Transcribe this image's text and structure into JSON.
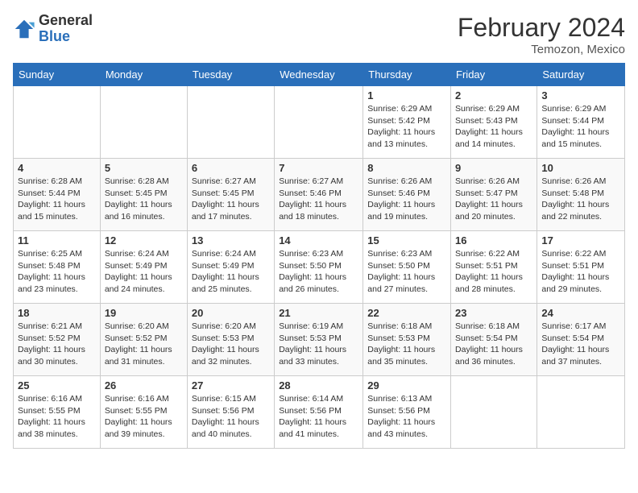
{
  "header": {
    "logo_general": "General",
    "logo_blue": "Blue",
    "title": "February 2024",
    "subtitle": "Temozon, Mexico"
  },
  "weekdays": [
    "Sunday",
    "Monday",
    "Tuesday",
    "Wednesday",
    "Thursday",
    "Friday",
    "Saturday"
  ],
  "weeks": [
    [
      {
        "day": "",
        "info": ""
      },
      {
        "day": "",
        "info": ""
      },
      {
        "day": "",
        "info": ""
      },
      {
        "day": "",
        "info": ""
      },
      {
        "day": "1",
        "info": "Sunrise: 6:29 AM\nSunset: 5:42 PM\nDaylight: 11 hours\nand 13 minutes."
      },
      {
        "day": "2",
        "info": "Sunrise: 6:29 AM\nSunset: 5:43 PM\nDaylight: 11 hours\nand 14 minutes."
      },
      {
        "day": "3",
        "info": "Sunrise: 6:29 AM\nSunset: 5:44 PM\nDaylight: 11 hours\nand 15 minutes."
      }
    ],
    [
      {
        "day": "4",
        "info": "Sunrise: 6:28 AM\nSunset: 5:44 PM\nDaylight: 11 hours\nand 15 minutes."
      },
      {
        "day": "5",
        "info": "Sunrise: 6:28 AM\nSunset: 5:45 PM\nDaylight: 11 hours\nand 16 minutes."
      },
      {
        "day": "6",
        "info": "Sunrise: 6:27 AM\nSunset: 5:45 PM\nDaylight: 11 hours\nand 17 minutes."
      },
      {
        "day": "7",
        "info": "Sunrise: 6:27 AM\nSunset: 5:46 PM\nDaylight: 11 hours\nand 18 minutes."
      },
      {
        "day": "8",
        "info": "Sunrise: 6:26 AM\nSunset: 5:46 PM\nDaylight: 11 hours\nand 19 minutes."
      },
      {
        "day": "9",
        "info": "Sunrise: 6:26 AM\nSunset: 5:47 PM\nDaylight: 11 hours\nand 20 minutes."
      },
      {
        "day": "10",
        "info": "Sunrise: 6:26 AM\nSunset: 5:48 PM\nDaylight: 11 hours\nand 22 minutes."
      }
    ],
    [
      {
        "day": "11",
        "info": "Sunrise: 6:25 AM\nSunset: 5:48 PM\nDaylight: 11 hours\nand 23 minutes."
      },
      {
        "day": "12",
        "info": "Sunrise: 6:24 AM\nSunset: 5:49 PM\nDaylight: 11 hours\nand 24 minutes."
      },
      {
        "day": "13",
        "info": "Sunrise: 6:24 AM\nSunset: 5:49 PM\nDaylight: 11 hours\nand 25 minutes."
      },
      {
        "day": "14",
        "info": "Sunrise: 6:23 AM\nSunset: 5:50 PM\nDaylight: 11 hours\nand 26 minutes."
      },
      {
        "day": "15",
        "info": "Sunrise: 6:23 AM\nSunset: 5:50 PM\nDaylight: 11 hours\nand 27 minutes."
      },
      {
        "day": "16",
        "info": "Sunrise: 6:22 AM\nSunset: 5:51 PM\nDaylight: 11 hours\nand 28 minutes."
      },
      {
        "day": "17",
        "info": "Sunrise: 6:22 AM\nSunset: 5:51 PM\nDaylight: 11 hours\nand 29 minutes."
      }
    ],
    [
      {
        "day": "18",
        "info": "Sunrise: 6:21 AM\nSunset: 5:52 PM\nDaylight: 11 hours\nand 30 minutes."
      },
      {
        "day": "19",
        "info": "Sunrise: 6:20 AM\nSunset: 5:52 PM\nDaylight: 11 hours\nand 31 minutes."
      },
      {
        "day": "20",
        "info": "Sunrise: 6:20 AM\nSunset: 5:53 PM\nDaylight: 11 hours\nand 32 minutes."
      },
      {
        "day": "21",
        "info": "Sunrise: 6:19 AM\nSunset: 5:53 PM\nDaylight: 11 hours\nand 33 minutes."
      },
      {
        "day": "22",
        "info": "Sunrise: 6:18 AM\nSunset: 5:53 PM\nDaylight: 11 hours\nand 35 minutes."
      },
      {
        "day": "23",
        "info": "Sunrise: 6:18 AM\nSunset: 5:54 PM\nDaylight: 11 hours\nand 36 minutes."
      },
      {
        "day": "24",
        "info": "Sunrise: 6:17 AM\nSunset: 5:54 PM\nDaylight: 11 hours\nand 37 minutes."
      }
    ],
    [
      {
        "day": "25",
        "info": "Sunrise: 6:16 AM\nSunset: 5:55 PM\nDaylight: 11 hours\nand 38 minutes."
      },
      {
        "day": "26",
        "info": "Sunrise: 6:16 AM\nSunset: 5:55 PM\nDaylight: 11 hours\nand 39 minutes."
      },
      {
        "day": "27",
        "info": "Sunrise: 6:15 AM\nSunset: 5:56 PM\nDaylight: 11 hours\nand 40 minutes."
      },
      {
        "day": "28",
        "info": "Sunrise: 6:14 AM\nSunset: 5:56 PM\nDaylight: 11 hours\nand 41 minutes."
      },
      {
        "day": "29",
        "info": "Sunrise: 6:13 AM\nSunset: 5:56 PM\nDaylight: 11 hours\nand 43 minutes."
      },
      {
        "day": "",
        "info": ""
      },
      {
        "day": "",
        "info": ""
      }
    ]
  ]
}
